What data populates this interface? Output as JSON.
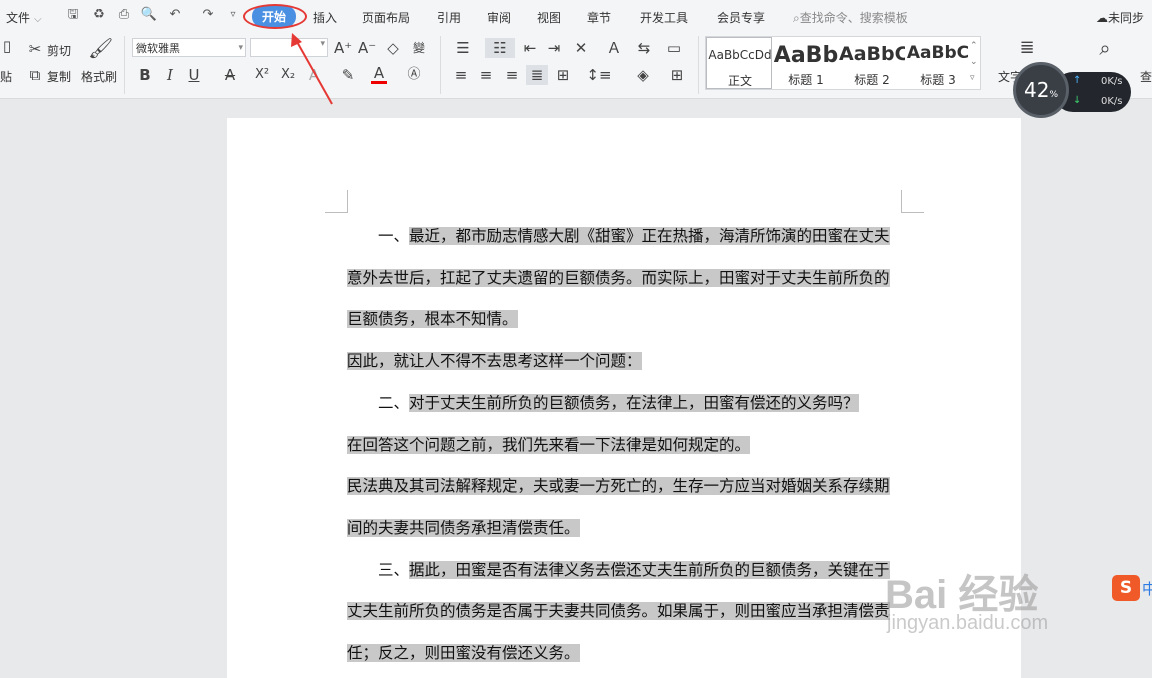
{
  "menubar": {
    "file_label": "文件",
    "tabs": [
      "开始",
      "插入",
      "页面布局",
      "引用",
      "审阅",
      "视图",
      "章节",
      "开发工具",
      "会员专享"
    ],
    "active_tab": "开始",
    "search_placeholder": "查找命令、搜索模板",
    "sync_label": "未同步"
  },
  "ribbon": {
    "paste_label": "贴",
    "cut_label": "剪切",
    "copy_label": "复制",
    "format_painter_label": "格式刷",
    "font_name": "微软雅黑",
    "font_size": "",
    "bold": "B",
    "italic": "I",
    "underline": "U",
    "superscript": "X²",
    "subscript": "X₂",
    "font_color": "A",
    "styles": [
      {
        "preview": "AaBbCcDd",
        "name": "正文"
      },
      {
        "preview": "AaBb",
        "name": "标题 1"
      },
      {
        "preview": "AaBbC",
        "name": "标题 2"
      },
      {
        "preview": "AaBbC",
        "name": "标题 3"
      }
    ],
    "text_layout_label": "文字排版",
    "find_label": "查找替换"
  },
  "speed_widget": {
    "percent": "42",
    "percent_unit": "%",
    "upload": "0K/s",
    "download": "0K/s"
  },
  "document": {
    "lines": [
      {
        "text": "　　一、最近，都市励志情感大剧《甜蜜》正在热播，海清所饰演的田蜜在丈夫",
        "hl_start": 4
      },
      {
        "text": "意外去世后，扛起了丈夫遗留的巨额债务。而实际上，田蜜对于丈夫生前所负的",
        "hl_start": 0
      },
      {
        "text": "巨额债务，根本不知情。",
        "hl_start": 0
      },
      {
        "text": "因此，就让人不得不去思考这样一个问题：",
        "hl_start": 0
      },
      {
        "text": "　　二、对于丈夫生前所负的巨额债务，在法律上，田蜜有偿还的义务吗？",
        "hl_start": 4
      },
      {
        "text": "在回答这个问题之前，我们先来看一下法律是如何规定的。",
        "hl_start": 0
      },
      {
        "text": "民法典及其司法解释规定，夫或妻一方死亡的，生存一方应当对婚姻关系存续期",
        "hl_start": 0
      },
      {
        "text": "间的夫妻共同债务承担清偿责任。",
        "hl_start": 0
      },
      {
        "text": "　　三、据此，田蜜是否有法律义务去偿还丈夫生前所负的巨额债务，关键在于",
        "hl_start": 4
      },
      {
        "text": "丈夫生前所负的债务是否属于夫妻共同债务。如果属于，则田蜜应当承担清偿责",
        "hl_start": 0
      },
      {
        "text": "任；反之，则田蜜没有偿还义务。",
        "hl_start": 0
      }
    ]
  },
  "watermark": {
    "logo": "Bai 经验",
    "url": "jingyan.baidu.com"
  },
  "sogou": {
    "label": "S",
    "zh": "中"
  },
  "colors": {
    "accent": "#4a90e2",
    "annotation": "#e53935",
    "selection": "#c8c8c8"
  }
}
